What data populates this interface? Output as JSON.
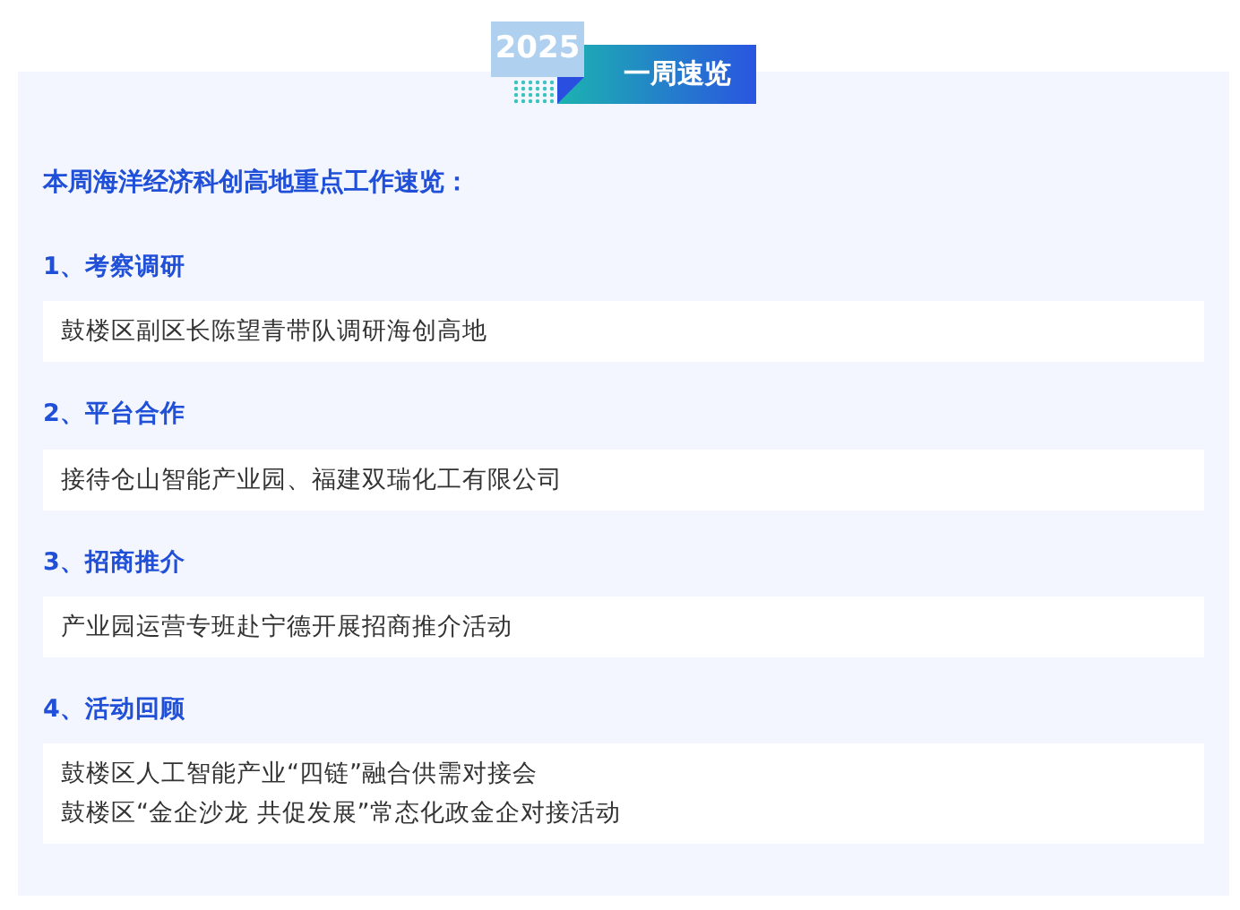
{
  "header": {
    "year": "2025",
    "title": "一周速览"
  },
  "intro": "本周海洋经济科创高地重点工作速览：",
  "sections": [
    {
      "heading": "1、考察调研",
      "items": [
        "鼓楼区副区长陈望青带队调研海创高地"
      ]
    },
    {
      "heading": "2、平台合作",
      "items": [
        "接待仓山智能产业园、福建双瑞化工有限公司"
      ]
    },
    {
      "heading": "3、招商推介",
      "items": [
        "产业园运营专班赴宁德开展招商推介活动"
      ]
    },
    {
      "heading": "4、活动回顾",
      "items": [
        "鼓楼区人工智能产业“四链”融合供需对接会",
        "鼓楼区“金企沙龙 共促发展”常态化政金企对接活动"
      ]
    }
  ]
}
